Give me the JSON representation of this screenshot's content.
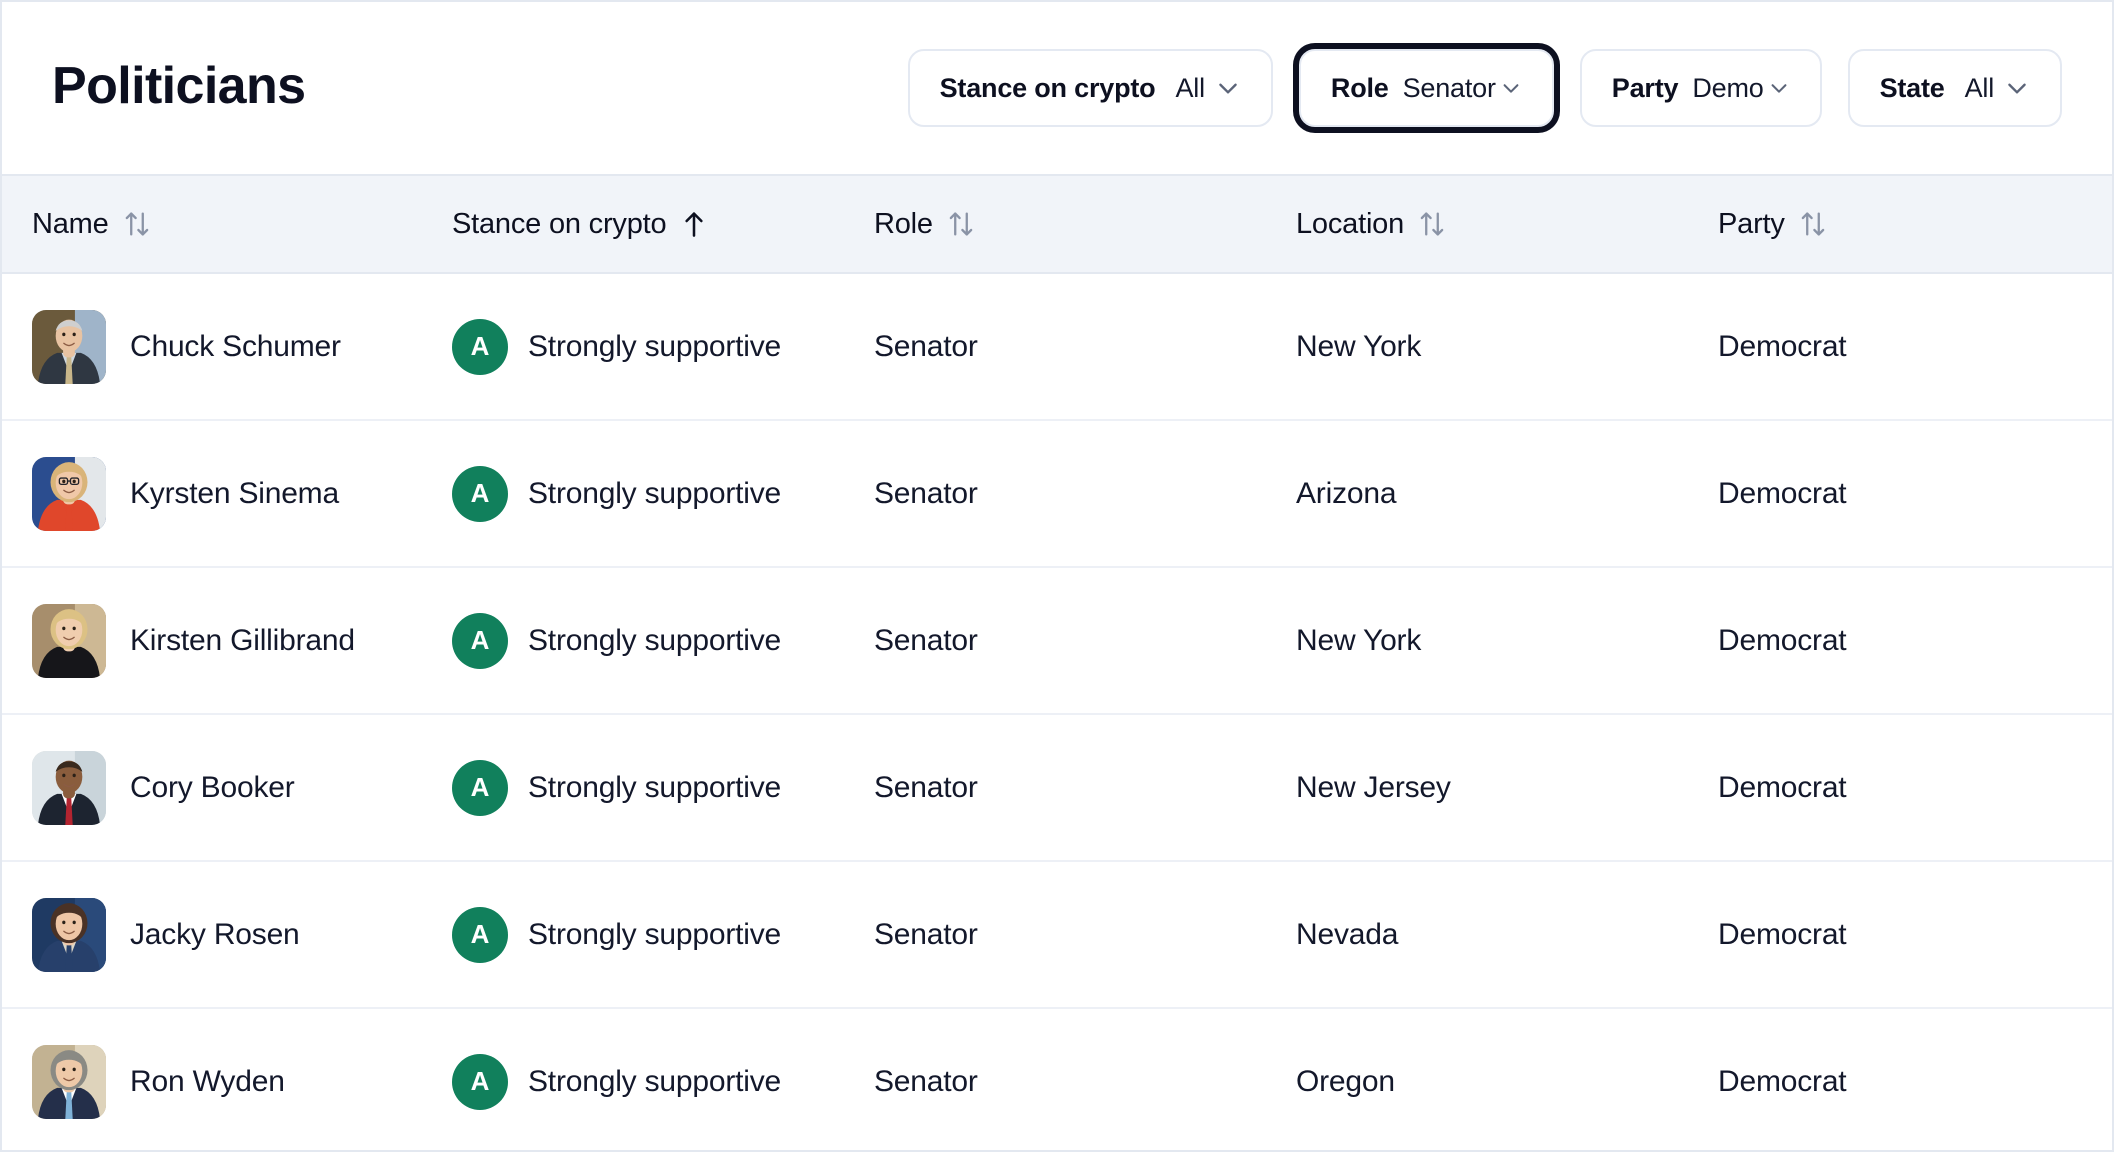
{
  "header": {
    "title": "Politicians",
    "filters": [
      {
        "id": "stance",
        "label": "Stance on crypto",
        "value": "All",
        "focused": false
      },
      {
        "id": "role",
        "label": "Role",
        "value": "Senator",
        "focused": true
      },
      {
        "id": "party",
        "label": "Party",
        "value": "Demo",
        "focused": false
      },
      {
        "id": "state",
        "label": "State",
        "value": "All",
        "focused": false
      }
    ]
  },
  "table": {
    "columns": [
      {
        "id": "name",
        "label": "Name",
        "sort": "none"
      },
      {
        "id": "stance",
        "label": "Stance on crypto",
        "sort": "asc"
      },
      {
        "id": "role",
        "label": "Role",
        "sort": "none"
      },
      {
        "id": "location",
        "label": "Location",
        "sort": "none"
      },
      {
        "id": "party",
        "label": "Party",
        "sort": "none"
      }
    ],
    "rows": [
      {
        "name": "Chuck Schumer",
        "stance_grade": "A",
        "stance": "Strongly supportive",
        "role": "Senator",
        "location": "New York",
        "party": "Democrat",
        "avatar": "chuck-schumer-avatar"
      },
      {
        "name": "Kyrsten Sinema",
        "stance_grade": "A",
        "stance": "Strongly supportive",
        "role": "Senator",
        "location": "Arizona",
        "party": "Democrat",
        "avatar": "kyrsten-sinema-avatar"
      },
      {
        "name": "Kirsten Gillibrand",
        "stance_grade": "A",
        "stance": "Strongly supportive",
        "role": "Senator",
        "location": "New York",
        "party": "Democrat",
        "avatar": "kirsten-gillibrand-avatar"
      },
      {
        "name": "Cory Booker",
        "stance_grade": "A",
        "stance": "Strongly supportive",
        "role": "Senator",
        "location": "New Jersey",
        "party": "Democrat",
        "avatar": "cory-booker-avatar"
      },
      {
        "name": "Jacky Rosen",
        "stance_grade": "A",
        "stance": "Strongly supportive",
        "role": "Senator",
        "location": "Nevada",
        "party": "Democrat",
        "avatar": "jacky-rosen-avatar"
      },
      {
        "name": "Ron Wyden",
        "stance_grade": "A",
        "stance": "Strongly supportive",
        "role": "Senator",
        "location": "Oregon",
        "party": "Democrat",
        "avatar": "ron-wyden-avatar"
      }
    ]
  },
  "colors": {
    "grade_a_green": "#11805C",
    "header_band": "#F1F4F9",
    "text_primary": "#13182B",
    "border": "#E3E8F0",
    "sort_inactive": "#8A93A6"
  },
  "icons": {
    "sort_inactive": "sort-both-icon",
    "sort_asc": "sort-asc-icon",
    "chevron": "chevron-down-icon"
  }
}
